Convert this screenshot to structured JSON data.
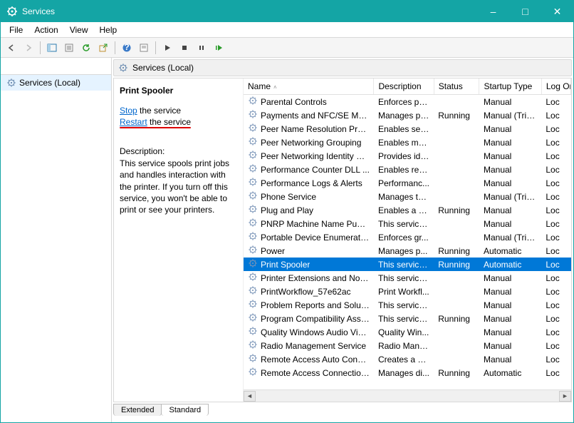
{
  "window": {
    "title": "Services"
  },
  "menu": {
    "items": [
      "File",
      "Action",
      "View",
      "Help"
    ]
  },
  "tree": {
    "root": "Services (Local)"
  },
  "pane": {
    "header": "Services (Local)"
  },
  "detail": {
    "selected_name": "Print Spooler",
    "stop_link": "Stop",
    "stop_suffix": " the service",
    "restart_link": "Restart",
    "restart_suffix": " the service",
    "desc_header": "Description:",
    "desc_body": "This service spools print jobs and handles interaction with the printer. If you turn off this service, you won't be able to print or see your printers."
  },
  "columns": {
    "name": "Name",
    "description": "Description",
    "status": "Status",
    "startup": "Startup Type",
    "logon": "Log On As"
  },
  "tabs": {
    "extended": "Extended",
    "standard": "Standard"
  },
  "services": [
    {
      "name": "Parental Controls",
      "desc": "Enforces pa...",
      "status": "",
      "startup": "Manual",
      "logon": "Loc",
      "selected": false
    },
    {
      "name": "Payments and NFC/SE Man...",
      "desc": "Manages pa...",
      "status": "Running",
      "startup": "Manual (Trig...",
      "logon": "Loc",
      "selected": false
    },
    {
      "name": "Peer Name Resolution Prot...",
      "desc": "Enables serv...",
      "status": "",
      "startup": "Manual",
      "logon": "Loc",
      "selected": false
    },
    {
      "name": "Peer Networking Grouping",
      "desc": "Enables mul...",
      "status": "",
      "startup": "Manual",
      "logon": "Loc",
      "selected": false
    },
    {
      "name": "Peer Networking Identity M...",
      "desc": "Provides ide...",
      "status": "",
      "startup": "Manual",
      "logon": "Loc",
      "selected": false
    },
    {
      "name": "Performance Counter DLL ...",
      "desc": "Enables rem...",
      "status": "",
      "startup": "Manual",
      "logon": "Loc",
      "selected": false
    },
    {
      "name": "Performance Logs & Alerts",
      "desc": "Performanc...",
      "status": "",
      "startup": "Manual",
      "logon": "Loc",
      "selected": false
    },
    {
      "name": "Phone Service",
      "desc": "Manages th...",
      "status": "",
      "startup": "Manual (Trig...",
      "logon": "Loc",
      "selected": false
    },
    {
      "name": "Plug and Play",
      "desc": "Enables a c...",
      "status": "Running",
      "startup": "Manual",
      "logon": "Loc",
      "selected": false
    },
    {
      "name": "PNRP Machine Name Publi...",
      "desc": "This service ...",
      "status": "",
      "startup": "Manual",
      "logon": "Loc",
      "selected": false
    },
    {
      "name": "Portable Device Enumerator...",
      "desc": "Enforces gr...",
      "status": "",
      "startup": "Manual (Trig...",
      "logon": "Loc",
      "selected": false
    },
    {
      "name": "Power",
      "desc": "Manages p...",
      "status": "Running",
      "startup": "Automatic",
      "logon": "Loc",
      "selected": false
    },
    {
      "name": "Print Spooler",
      "desc": "This service ...",
      "status": "Running",
      "startup": "Automatic",
      "logon": "Loc",
      "selected": true
    },
    {
      "name": "Printer Extensions and Notif...",
      "desc": "This service ...",
      "status": "",
      "startup": "Manual",
      "logon": "Loc",
      "selected": false
    },
    {
      "name": "PrintWorkflow_57e62ac",
      "desc": "Print Workfl...",
      "status": "",
      "startup": "Manual",
      "logon": "Loc",
      "selected": false
    },
    {
      "name": "Problem Reports and Soluti...",
      "desc": "This service ...",
      "status": "",
      "startup": "Manual",
      "logon": "Loc",
      "selected": false
    },
    {
      "name": "Program Compatibility Assi...",
      "desc": "This service ...",
      "status": "Running",
      "startup": "Manual",
      "logon": "Loc",
      "selected": false
    },
    {
      "name": "Quality Windows Audio Vid...",
      "desc": "Quality Win...",
      "status": "",
      "startup": "Manual",
      "logon": "Loc",
      "selected": false
    },
    {
      "name": "Radio Management Service",
      "desc": "Radio Mana...",
      "status": "",
      "startup": "Manual",
      "logon": "Loc",
      "selected": false
    },
    {
      "name": "Remote Access Auto Conne...",
      "desc": "Creates a co...",
      "status": "",
      "startup": "Manual",
      "logon": "Loc",
      "selected": false
    },
    {
      "name": "Remote Access Connection...",
      "desc": "Manages di...",
      "status": "Running",
      "startup": "Automatic",
      "logon": "Loc",
      "selected": false
    }
  ]
}
